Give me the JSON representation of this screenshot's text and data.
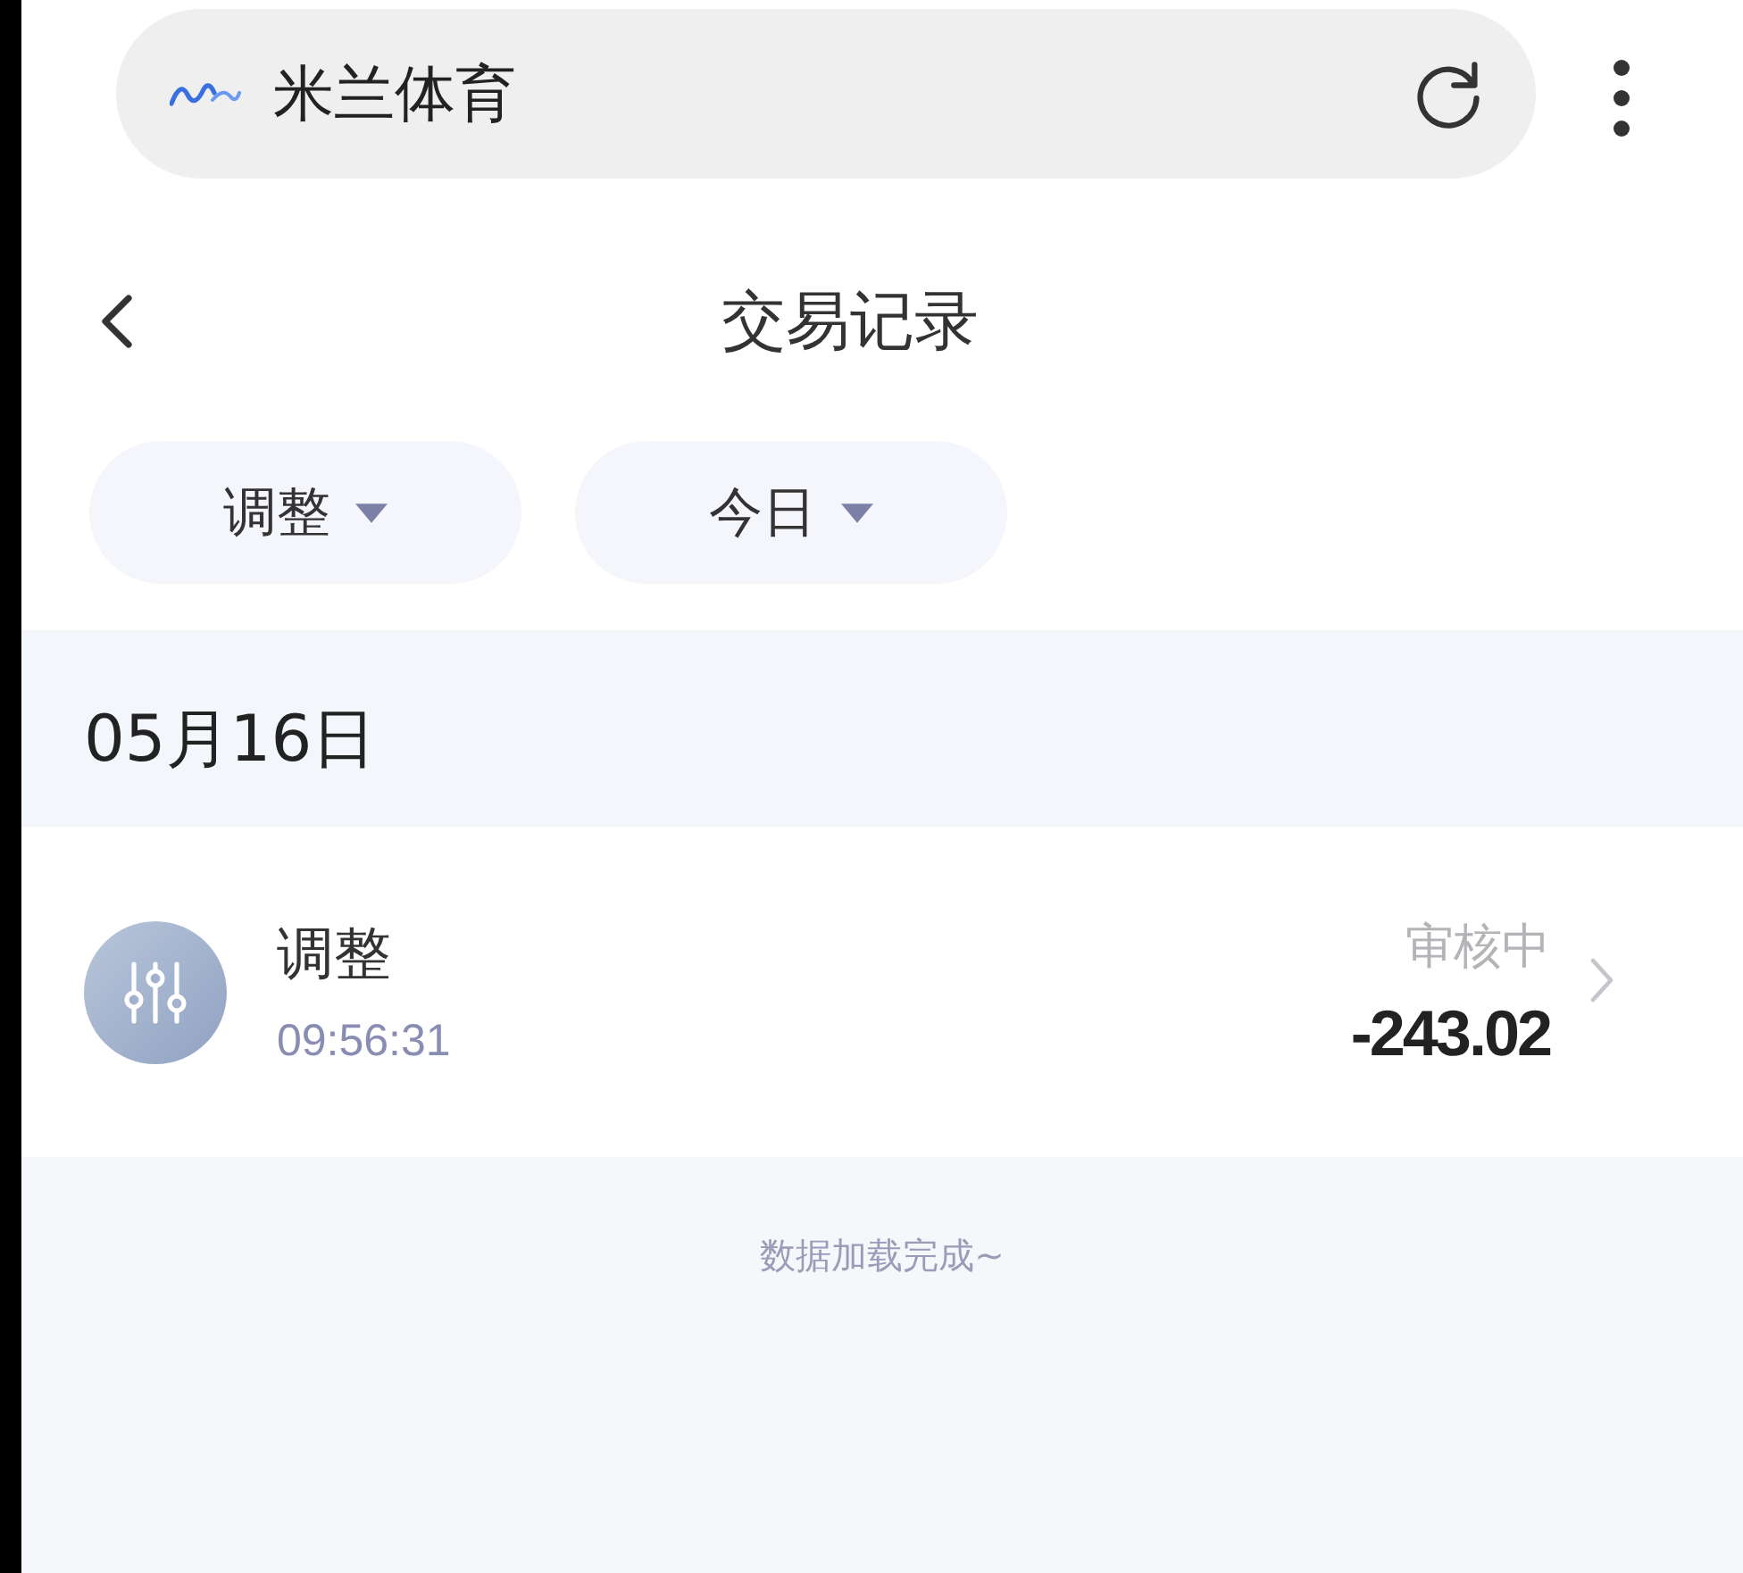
{
  "browser": {
    "site_name": "米兰体育"
  },
  "header": {
    "title": "交易记录"
  },
  "filters": [
    {
      "label": "调整"
    },
    {
      "label": "今日"
    }
  ],
  "groups": [
    {
      "date": "05月16日",
      "records": [
        {
          "title": "调整",
          "time": "09:56:31",
          "status": "审核中",
          "amount": "-243.02"
        }
      ]
    }
  ],
  "footer": {
    "message": "数据加载完成~"
  }
}
